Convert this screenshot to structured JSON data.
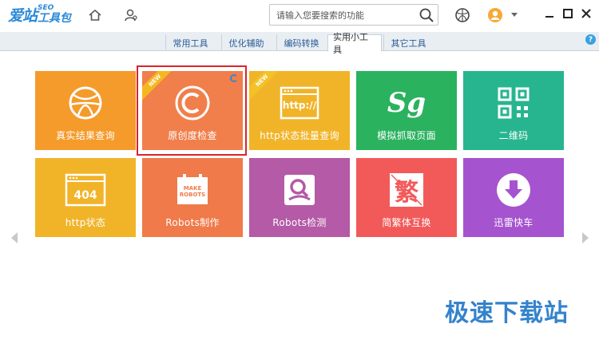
{
  "app": {
    "logo_text": "爱站",
    "logo_seo": "SEO",
    "logo_tail": "工具包"
  },
  "toolbar": {
    "icons": [
      "home-icon",
      "user-settings-icon",
      "ball-icon",
      "user-avatar-icon",
      "dropdown-icon",
      "minimize-icon",
      "maximize-icon",
      "close-icon"
    ]
  },
  "search": {
    "placeholder": "请输入您要搜索的功能"
  },
  "tabs": [
    {
      "label": "常用工具",
      "active": false
    },
    {
      "label": "优化辅助",
      "active": false
    },
    {
      "label": "编码转换",
      "active": false
    },
    {
      "label": "实用小工具",
      "active": true
    },
    {
      "label": "其它工具",
      "active": false
    }
  ],
  "help_label": "?",
  "tiles": [
    {
      "label": "真实结果查询",
      "color": "#f59b2b",
      "icon": "basketball-icon",
      "badge": ""
    },
    {
      "label": "原创度检查",
      "color": "#f07f4b",
      "icon": "copyright-icon",
      "badge": "NEW",
      "selected": true
    },
    {
      "label": "http状态批量查询",
      "color": "#f1b429",
      "icon": "http-browser-icon",
      "badge": "NEW"
    },
    {
      "label": "模拟抓取页面",
      "color": "#2bb25f",
      "icon": "spider-sg-icon",
      "badge": ""
    },
    {
      "label": "二维码",
      "color": "#27b58f",
      "icon": "qr-code-icon",
      "badge": ""
    },
    {
      "label": "http状态",
      "color": "#f1b429",
      "icon": "404-icon",
      "badge": ""
    },
    {
      "label": "Robots制作",
      "color": "#f07a4a",
      "icon": "make-robots-icon",
      "badge": ""
    },
    {
      "label": "Robots检测",
      "color": "#b45aa6",
      "icon": "robots-check-icon",
      "badge": ""
    },
    {
      "label": "简繁体互换",
      "color": "#f25a5a",
      "icon": "traditional-chinese-icon",
      "badge": ""
    },
    {
      "label": "迅雷快车",
      "color": "#a653cf",
      "icon": "download-icon",
      "badge": ""
    }
  ],
  "tile_glyphs": {
    "http": "http://",
    "sg": "Sg",
    "make_robots": "MAKE ROBOTS",
    "fan": "繁"
  },
  "watermark": "极速下载站"
}
